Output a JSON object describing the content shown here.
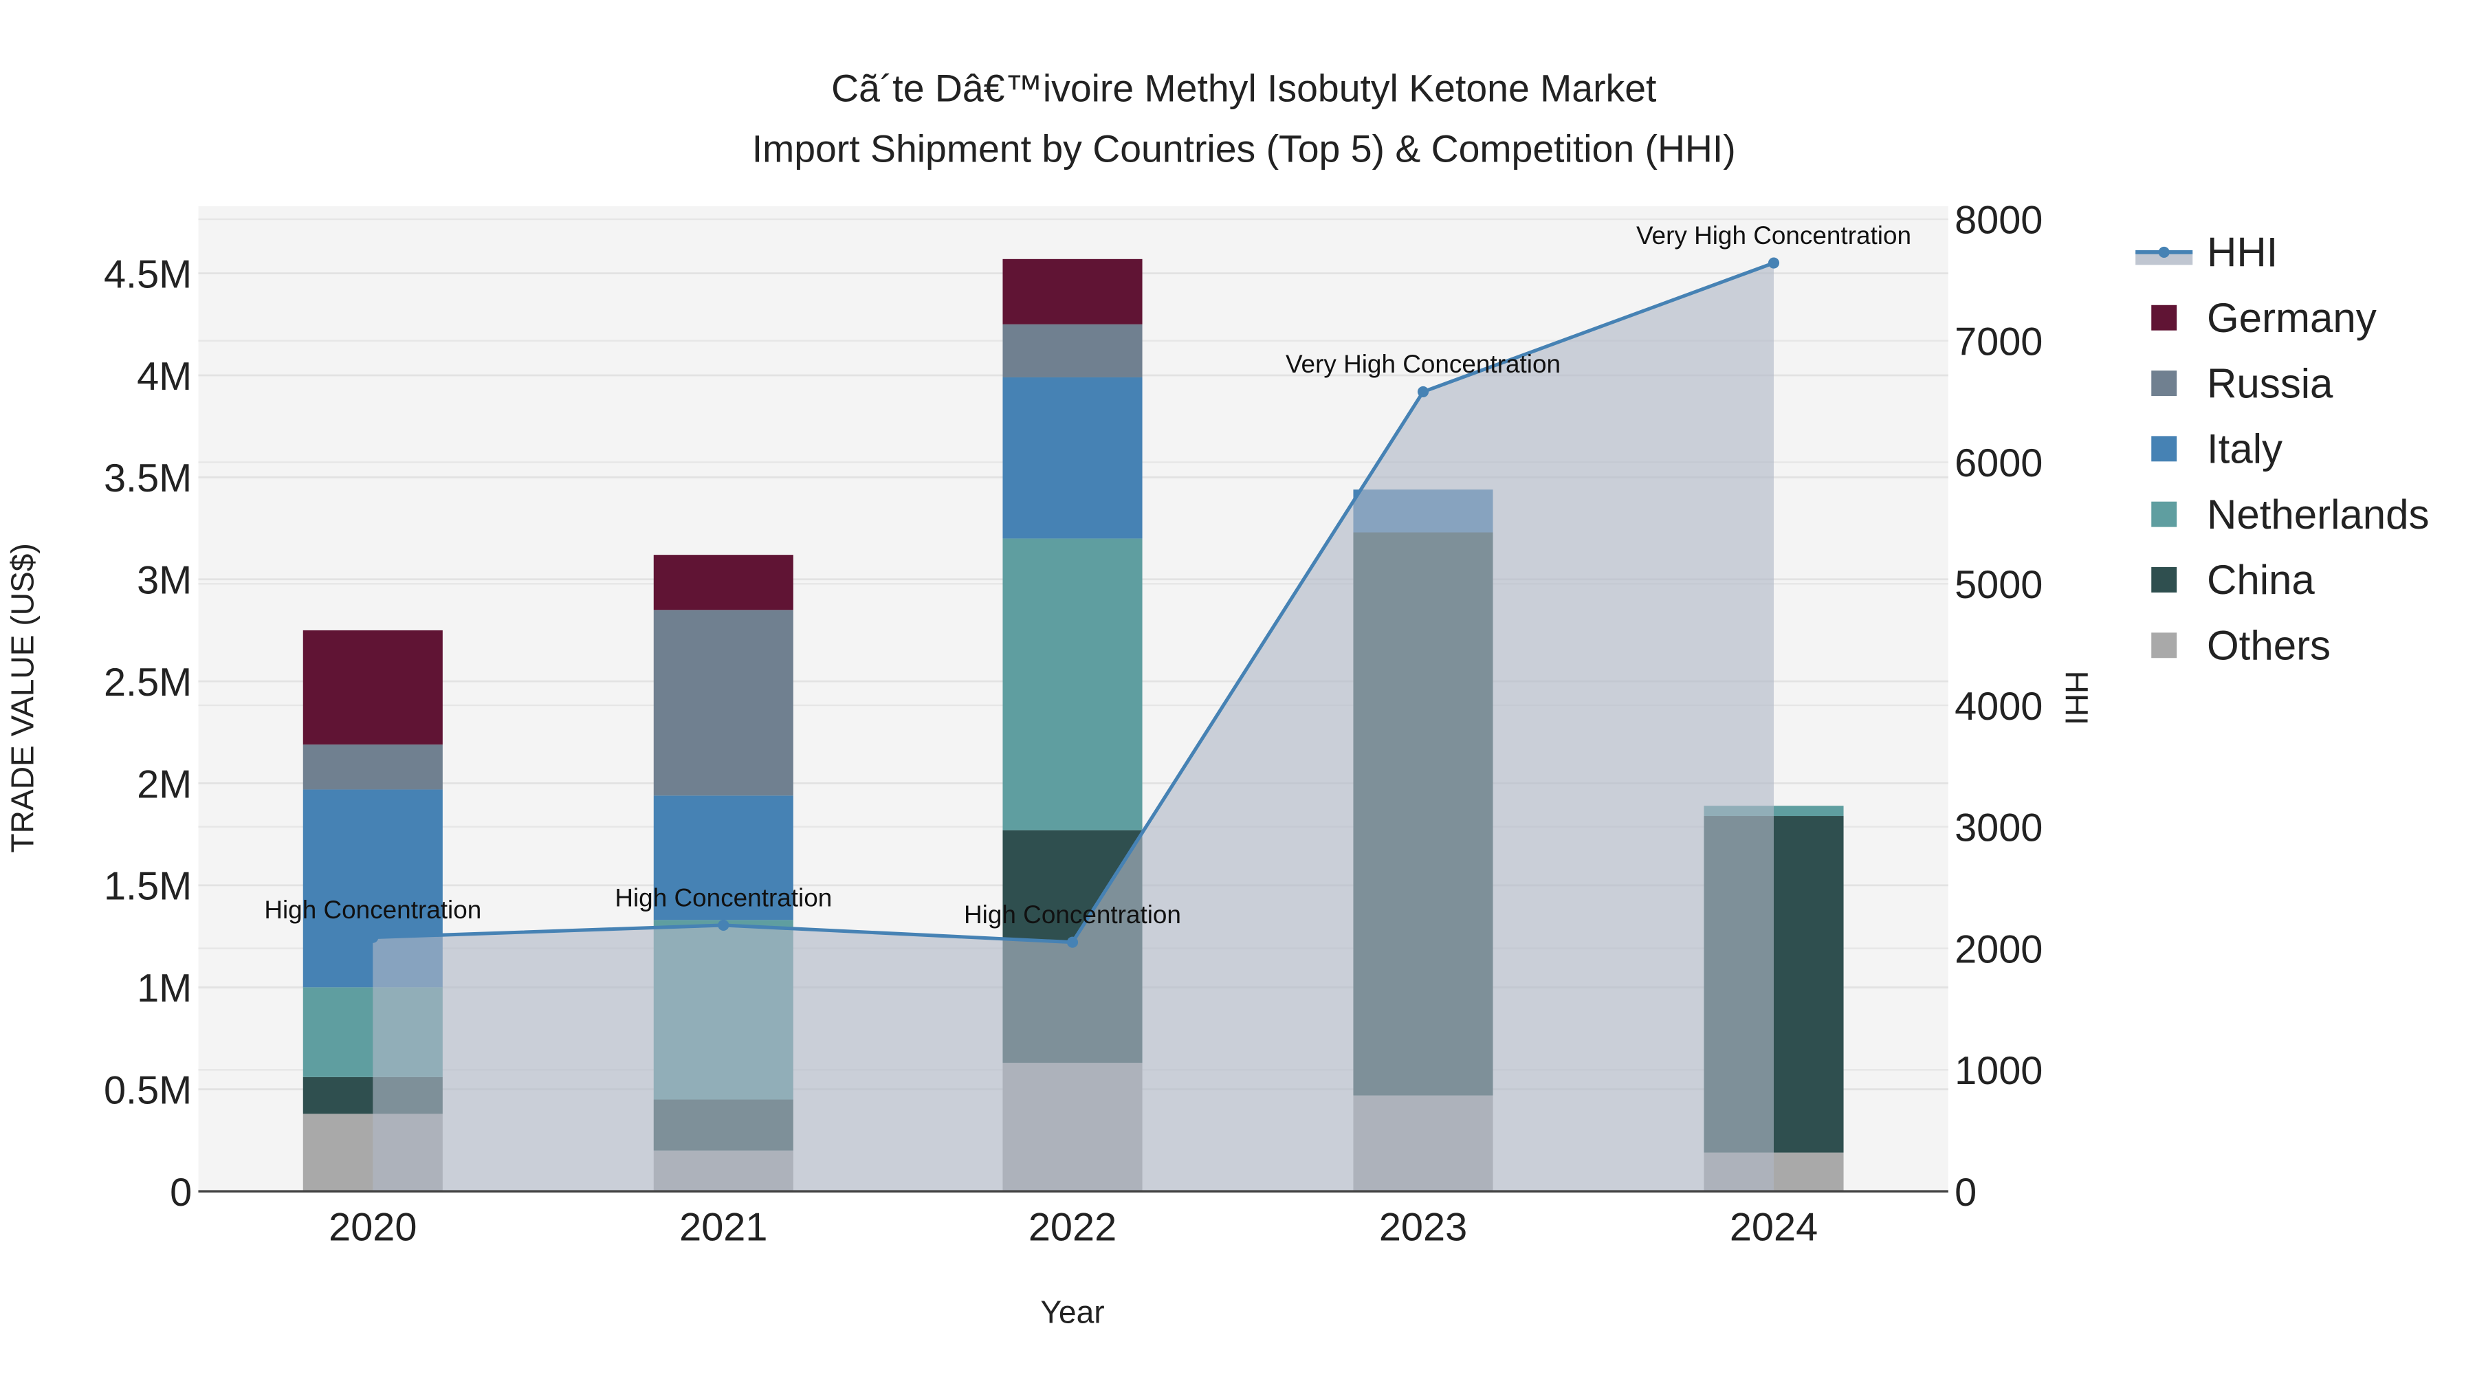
{
  "chart_data": {
    "type": "bar",
    "title_line1": "Cã´te Dâ€™ivoire Methyl Isobutyl Ketone Market",
    "title_line2": "Import Shipment by Countries (Top 5) & Competition (HHI)",
    "xlabel": "Year",
    "ylabel": "TRADE VALUE (US$)",
    "y2label": "HHI",
    "categories": [
      "2020",
      "2021",
      "2022",
      "2023",
      "2024"
    ],
    "ylim": [
      0,
      4800000
    ],
    "y2lim": [
      0,
      8100
    ],
    "yticks": [
      0,
      500000,
      1000000,
      1500000,
      2000000,
      2500000,
      3000000,
      3500000,
      4000000,
      4500000
    ],
    "yticklabels": [
      "0",
      "0.5M",
      "1M",
      "1.5M",
      "2M",
      "2.5M",
      "3M",
      "3.5M",
      "4M",
      "4.5M"
    ],
    "y2ticks": [
      0,
      1000,
      2000,
      3000,
      4000,
      5000,
      6000,
      7000,
      8000
    ],
    "y2ticklabels": [
      "0",
      "1000",
      "2000",
      "3000",
      "4000",
      "5000",
      "6000",
      "7000",
      "8000"
    ],
    "grid": true,
    "legend_position": "right",
    "series": [
      {
        "name": "Others",
        "color": "#a9a9a9",
        "values": [
          380000,
          200000,
          630000,
          470000,
          190000
        ]
      },
      {
        "name": "China",
        "color": "#2f4f4f",
        "values": [
          180000,
          250000,
          1140000,
          2760000,
          1650000
        ]
      },
      {
        "name": "Netherlands",
        "color": "#5f9ea0",
        "values": [
          440000,
          880000,
          1430000,
          0,
          50000
        ]
      },
      {
        "name": "Italy",
        "color": "#4682b4",
        "values": [
          970000,
          610000,
          790000,
          210000,
          0
        ]
      },
      {
        "name": "Russia",
        "color": "#708090",
        "values": [
          220000,
          910000,
          260000,
          0,
          0
        ]
      },
      {
        "name": "Germany",
        "color": "#601434",
        "values": [
          560000,
          270000,
          320000,
          0,
          0
        ]
      }
    ],
    "hhi": {
      "name": "HHI",
      "color": "#4682b4",
      "values": [
        2090,
        2190,
        2050,
        6580,
        7640
      ],
      "annotations": [
        "High Concentration",
        "High Concentration",
        "High Concentration",
        "Very High Concentration",
        "Very High Concentration"
      ]
    },
    "legend_order": [
      "HHI",
      "Germany",
      "Russia",
      "Italy",
      "Netherlands",
      "China",
      "Others"
    ]
  }
}
